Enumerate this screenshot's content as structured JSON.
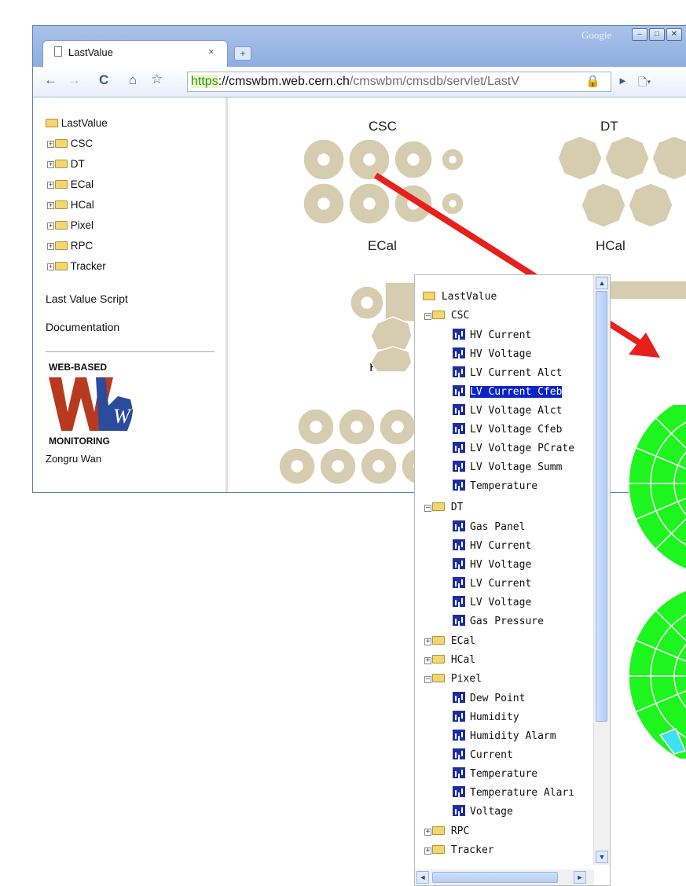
{
  "browser": {
    "brand": "Google",
    "tab_title": "LastValue",
    "tab_close": "×",
    "new_tab": "+",
    "url_scheme": "https",
    "url_host": "://cmswbm.web.cern.ch",
    "url_path": "/cmswbm/cmsdb/servlet/LastV",
    "buttons": {
      "back": "←",
      "forward": "→",
      "reload": "C",
      "home": "⌂",
      "go": "►",
      "page": "🗋▾",
      "star": "☆",
      "lock": "🔒"
    }
  },
  "sidebar": {
    "root": "LastValue",
    "items": [
      "CSC",
      "DT",
      "ECal",
      "HCal",
      "Pixel",
      "RPC",
      "Tracker"
    ],
    "links": [
      "Last Value Script",
      "Documentation"
    ],
    "logo_top": "WEB-BASED",
    "logo_mark": "WbM",
    "logo_bottom": "MONITORING",
    "author": "Zongru Wan"
  },
  "detectors": [
    "CSC",
    "DT",
    "ECal",
    "HCal",
    "RPC"
  ],
  "overlay_tree": {
    "root": "LastValue",
    "csc": {
      "label": "CSC",
      "items": [
        "HV Current",
        "HV Voltage",
        "LV Current Alct",
        "LV Current Cfeb",
        "LV Voltage Alct",
        "LV Voltage Cfeb",
        "LV Voltage PCrate",
        "LV Voltage Summ",
        "Temperature"
      ],
      "selected": "LV Current Cfeb"
    },
    "dt": {
      "label": "DT",
      "items": [
        "Gas Panel",
        "HV Current",
        "HV Voltage",
        "LV Current",
        "LV Voltage",
        "Gas Pressure"
      ]
    },
    "ecal": "ECal",
    "hcal": "HCal",
    "pixel": {
      "label": "Pixel",
      "items": [
        "Dew Point",
        "Humidity",
        "Humidity Alarm",
        "Current",
        "Temperature",
        "Temperature Aları",
        "Voltage"
      ]
    },
    "rpc": "RPC",
    "tracker": "Tracker"
  },
  "colors": {
    "arrow": "#e8201c",
    "status_ok": "#1ef51e",
    "status_alt": "#3fe0f0",
    "chamber": "#d6ccaf"
  }
}
